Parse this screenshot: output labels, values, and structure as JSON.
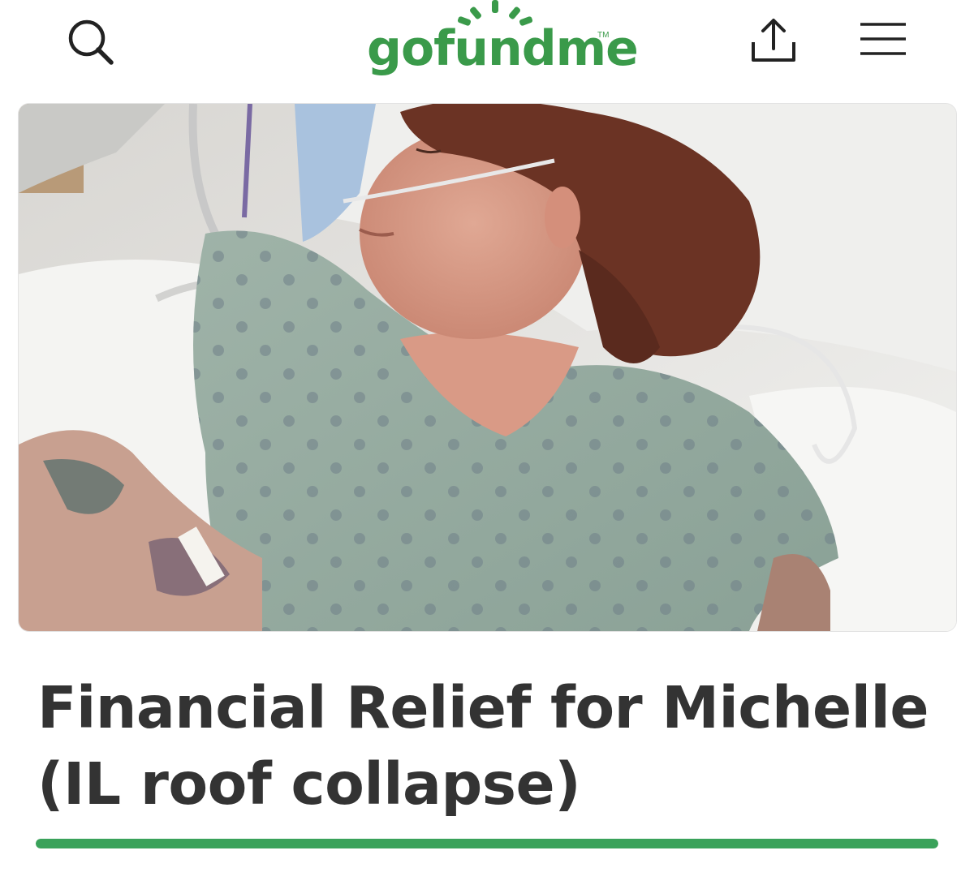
{
  "header": {
    "logo_text": "gofundme",
    "logo_tm": "TM",
    "search_icon": "search-icon",
    "share_icon": "share-icon",
    "menu_icon": "hamburger-menu-icon",
    "brand_color": "#3a9a4a"
  },
  "campaign": {
    "title_line1": "Financial Relief for Michelle",
    "title_line2": "(IL roof collapse)",
    "progress_fraction": 1.0,
    "progress_color": "#3aa25a"
  }
}
